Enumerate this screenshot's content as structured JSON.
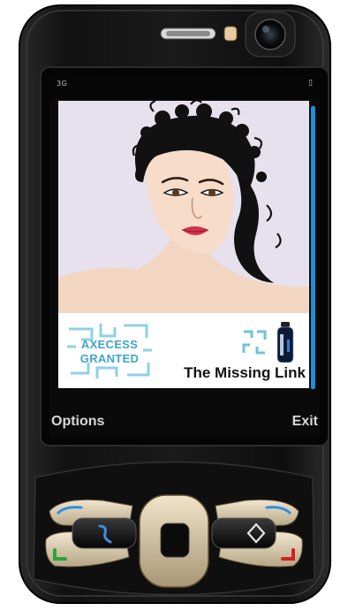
{
  "status": {
    "network": "3G",
    "battery": "▯"
  },
  "content": {
    "brand_line1": "AXECESS",
    "brand_line2": "GRANTED",
    "tagline": "The Missing Link"
  },
  "softkeys": {
    "left": "Options",
    "right": "Exit"
  },
  "icons": {
    "navi": "navi-key-icon",
    "call": "call-key-icon",
    "end": "end-key-icon",
    "multimedia": "multimedia-key-icon"
  },
  "colors": {
    "accent": "#1c8fd6",
    "brand": "#3fa6c9",
    "phone_body": "#161616"
  }
}
